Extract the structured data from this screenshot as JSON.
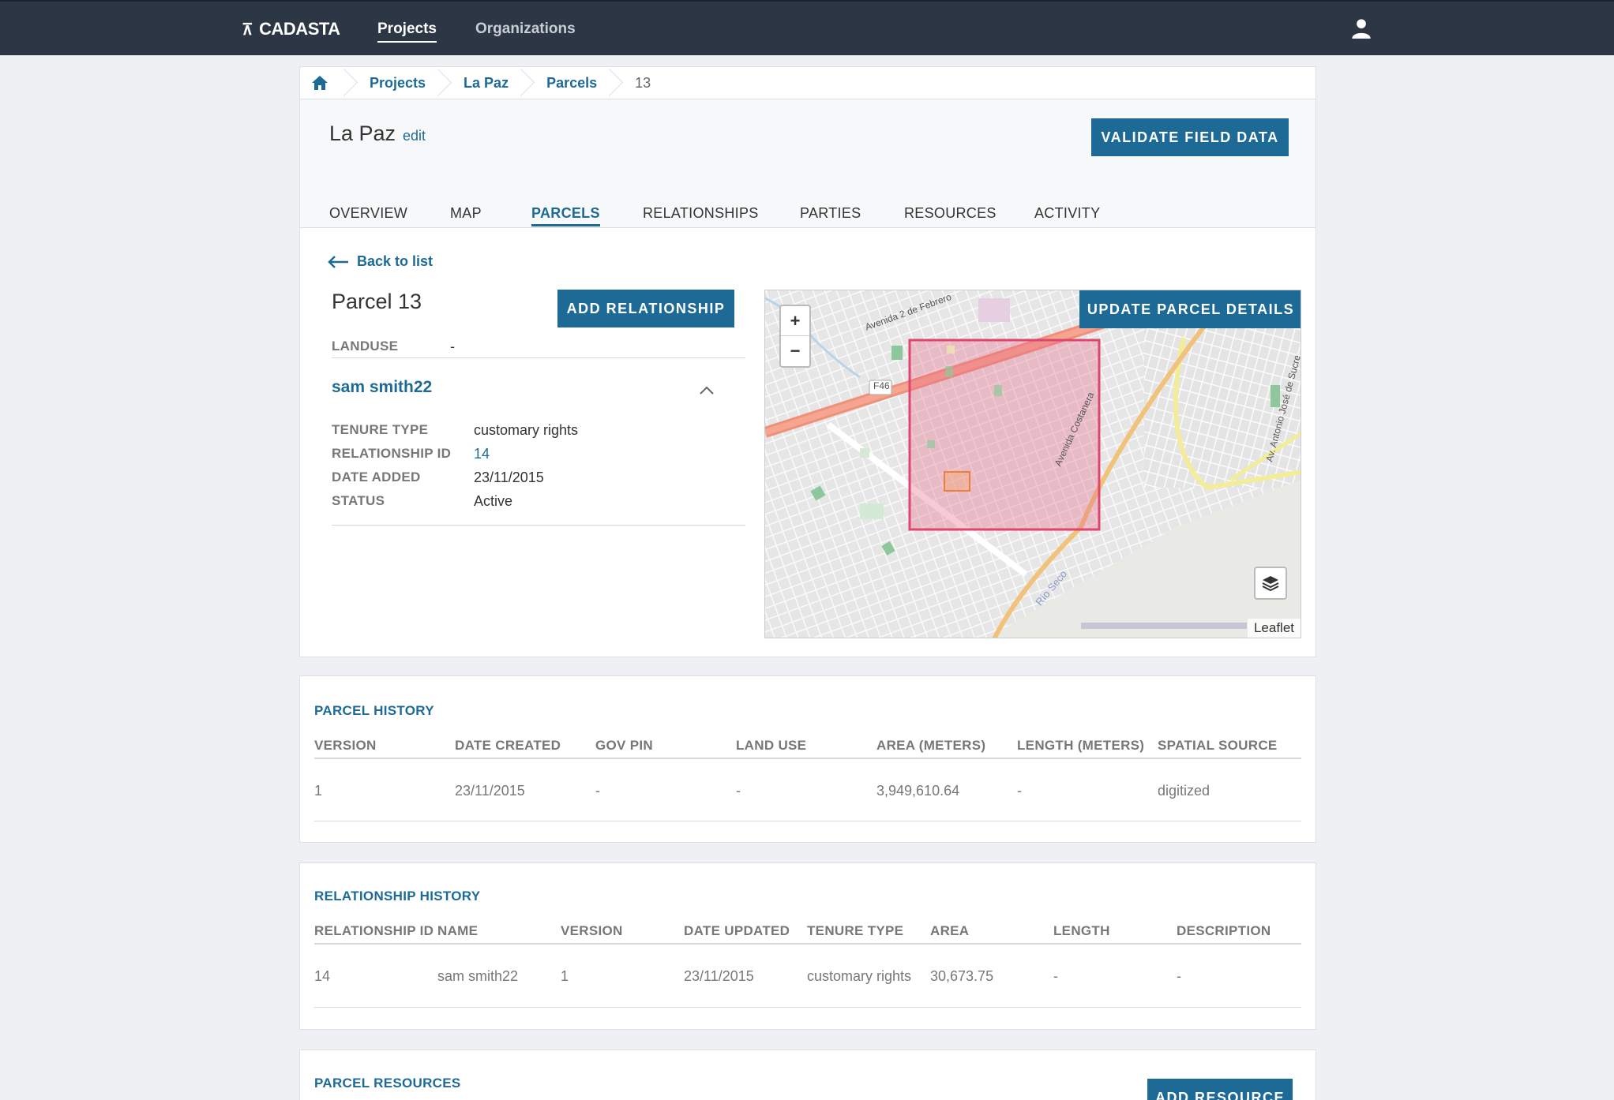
{
  "app": {
    "brand": "CADASTA",
    "nav": [
      {
        "label": "Projects",
        "active": true
      },
      {
        "label": "Organizations",
        "active": false
      }
    ]
  },
  "breadcrumb": {
    "items": [
      "Projects",
      "La Paz",
      "Parcels"
    ],
    "current": "13"
  },
  "project": {
    "title": "La Paz",
    "edit_label": "edit",
    "validate_label": "VALIDATE FIELD DATA"
  },
  "tabs": [
    {
      "label": "OVERVIEW",
      "active": false
    },
    {
      "label": "MAP",
      "active": false
    },
    {
      "label": "PARCELS",
      "active": true
    },
    {
      "label": "RELATIONSHIPS",
      "active": false
    },
    {
      "label": "PARTIES",
      "active": false
    },
    {
      "label": "RESOURCES",
      "active": false
    },
    {
      "label": "ACTIVITY",
      "active": false
    }
  ],
  "parcel": {
    "back_label": "Back to list",
    "title": "Parcel 13",
    "add_relationship_label": "ADD RELATIONSHIP",
    "update_label": "UPDATE PARCEL DETAILS",
    "landuse_label": "LANDUSE",
    "landuse_value": "-",
    "relationship": {
      "party_name": "sam smith22",
      "fields": [
        {
          "label": "TENURE TYPE",
          "value": "customary rights"
        },
        {
          "label": "RELATIONSHIP ID",
          "value": "14"
        },
        {
          "label": "DATE ADDED",
          "value": "23/11/2015"
        },
        {
          "label": "STATUS",
          "value": "Active"
        }
      ]
    }
  },
  "map": {
    "zoom_in": "+",
    "zoom_out": "−",
    "attribution": "Leaflet",
    "labels": {
      "road1": "Avenida 2 de Febrero",
      "road_code": "F46",
      "road2": "Avenida Costanera",
      "road3": "Av. Antonio José de Sucre",
      "river": "Río Seco"
    },
    "parcel_fill": "#e86a8a",
    "parcel_stroke": "#e0456e"
  },
  "parcel_history": {
    "title": "PARCEL HISTORY",
    "columns": [
      "VERSION",
      "DATE CREATED",
      "GOV PIN",
      "LAND USE",
      "AREA (METERS)",
      "LENGTH (METERS)",
      "SPATIAL SOURCE"
    ],
    "rows": [
      [
        "1",
        "23/11/2015",
        "-",
        "-",
        "3,949,610.64",
        "-",
        "digitized"
      ]
    ]
  },
  "relationship_history": {
    "title": "RELATIONSHIP HISTORY",
    "columns": [
      "RELATIONSHIP ID",
      "NAME",
      "VERSION",
      "DATE UPDATED",
      "TENURE TYPE",
      "AREA",
      "LENGTH",
      "DESCRIPTION"
    ],
    "rows": [
      [
        "14",
        "sam smith22",
        "1",
        "23/11/2015",
        "customary rights",
        "30,673.75",
        "-",
        "-"
      ]
    ]
  },
  "parcel_resources": {
    "title": "PARCEL RESOURCES",
    "add_label": "ADD RESOURCE"
  },
  "colors": {
    "primary": "#1d6a96",
    "navbar": "#2c3645",
    "background": "#eef0f3"
  }
}
